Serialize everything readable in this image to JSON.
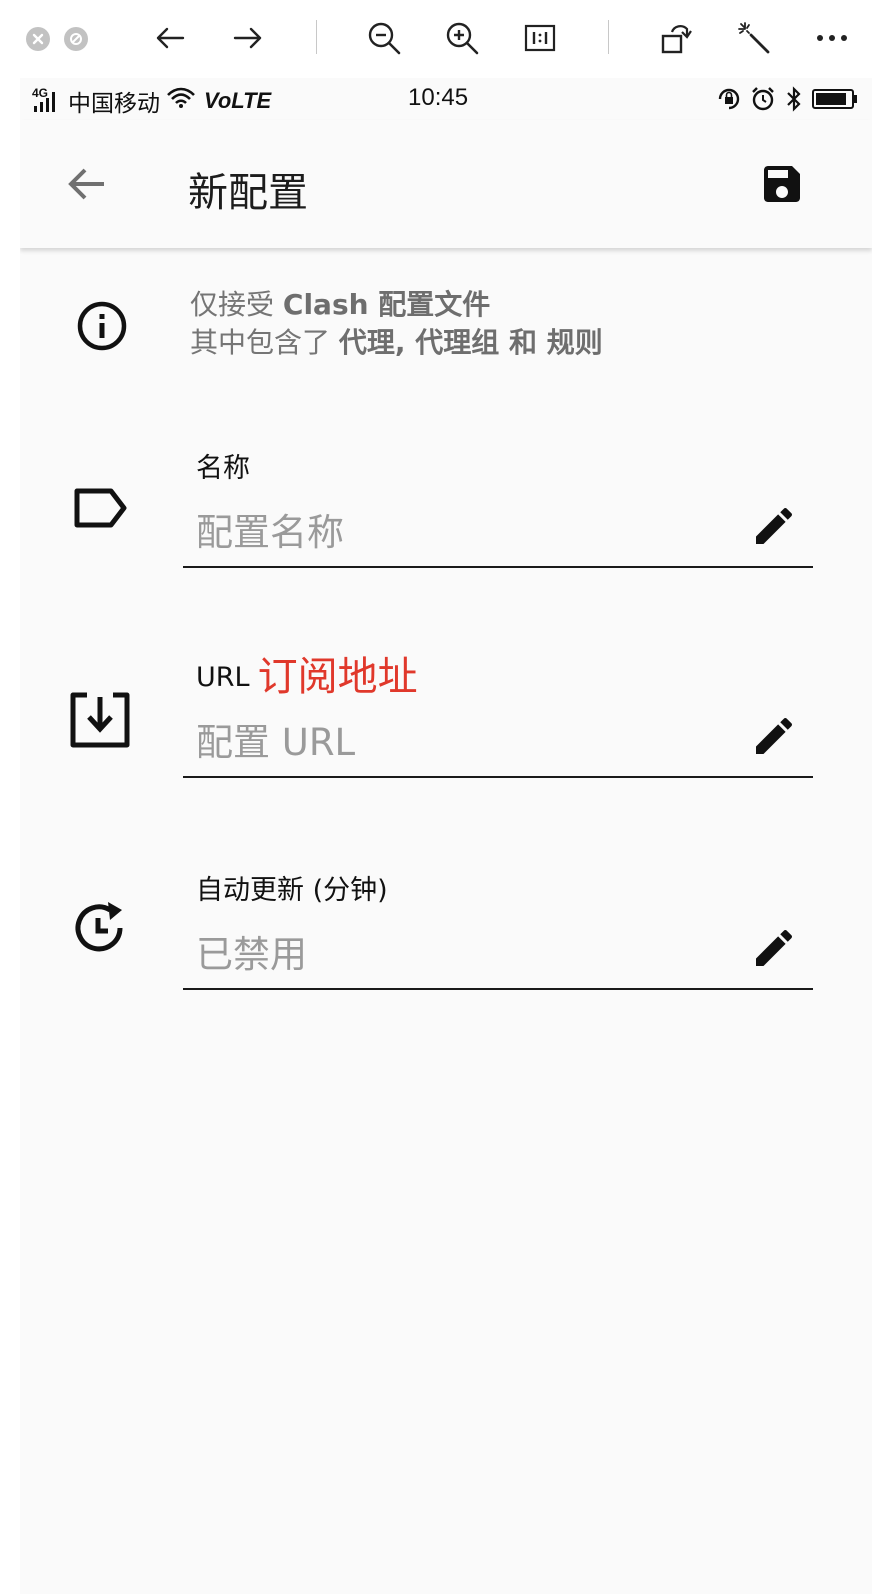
{
  "viewer_toolbar": {
    "icons": [
      "close-icon",
      "minimize-icon",
      "back-arrow-icon",
      "forward-arrow-icon",
      "zoom-out-icon",
      "zoom-in-icon",
      "actual-size-icon",
      "rotate-icon",
      "magic-wand-icon",
      "more-icon"
    ]
  },
  "statusbar": {
    "network": "4G",
    "carrier": "中国移动",
    "volte": "VoLTE",
    "time": "10:45",
    "icons": [
      "rotation-lock-icon",
      "alarm-icon",
      "bluetooth-icon",
      "battery-icon"
    ]
  },
  "appbar": {
    "title": "新配置",
    "back_icon": "arrow-left-icon",
    "save_icon": "save-icon"
  },
  "info": {
    "icon": "info-icon",
    "line1_prefix": "仅接受 ",
    "line1_bold": "Clash 配置文件",
    "line2_prefix": "其中包含了 ",
    "line2_bold": "代理, 代理组 和 规则"
  },
  "fields": [
    {
      "icon": "label-tag-icon",
      "label": "名称",
      "note": "",
      "value": "配置名称",
      "edit_icon": "pencil-icon"
    },
    {
      "icon": "download-box-icon",
      "label": "URL",
      "note": "订阅地址",
      "value": "配置 URL",
      "edit_icon": "pencil-icon"
    },
    {
      "icon": "clock-refresh-icon",
      "label": "自动更新 (分钟)",
      "note": "",
      "value": "已禁用",
      "edit_icon": "pencil-icon"
    }
  ],
  "colors": {
    "background": "#fafafa",
    "annotation_red": "#e0382b",
    "hint_gray": "#9a9a9a"
  }
}
